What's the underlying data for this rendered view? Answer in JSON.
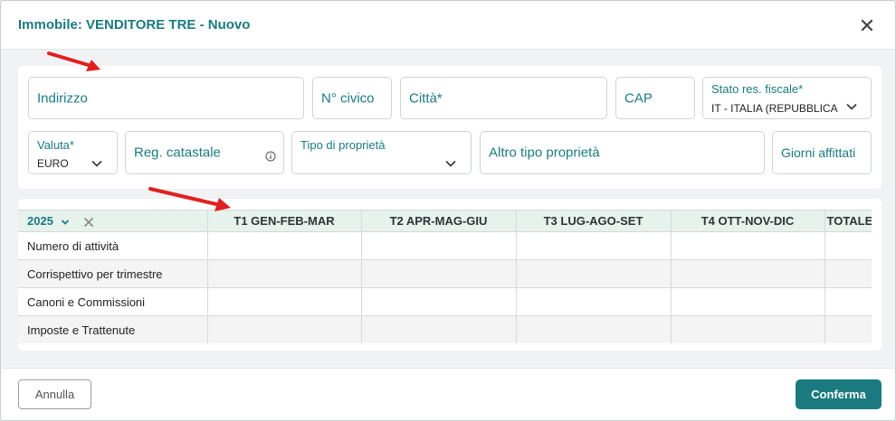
{
  "modal": {
    "title": "Immobile: VENDITORE TRE - Nuovo",
    "close_glyph": "✕"
  },
  "form": {
    "indirizzo": "Indirizzo",
    "civico": "N° civico",
    "citta": "Città*",
    "cap": "CAP",
    "stato_label": "Stato res. fiscale*",
    "stato_value": "IT - ITALIA (REPUBBLICA",
    "valuta_label": "Valuta*",
    "valuta_value": "EURO",
    "reg_catastale": "Reg. catastale",
    "tipo_label": "Tipo di proprietà",
    "altro_tipo": "Altro tipo proprietà",
    "giorni": "Giorni affittati"
  },
  "table": {
    "year": "2025",
    "columns": [
      "T1 GEN-FEB-MAR",
      "T2 APR-MAG-GIU",
      "T3 LUG-AGO-SET",
      "T4 OTT-NOV-DIC",
      "TOTALE"
    ],
    "rows": [
      "Numero di attività",
      "Corrispettivo per trimestre",
      "Canoni e Commissioni",
      "Imposte e Trattenute"
    ]
  },
  "footer": {
    "cancel": "Annulla",
    "confirm": "Conferma"
  },
  "colors": {
    "accent": "#1b7a80",
    "annotation_arrow": "#e02020"
  },
  "icons": [
    "close-icon",
    "chevron-down-icon",
    "info-icon",
    "clear-icon",
    "arrow-annotation"
  ]
}
